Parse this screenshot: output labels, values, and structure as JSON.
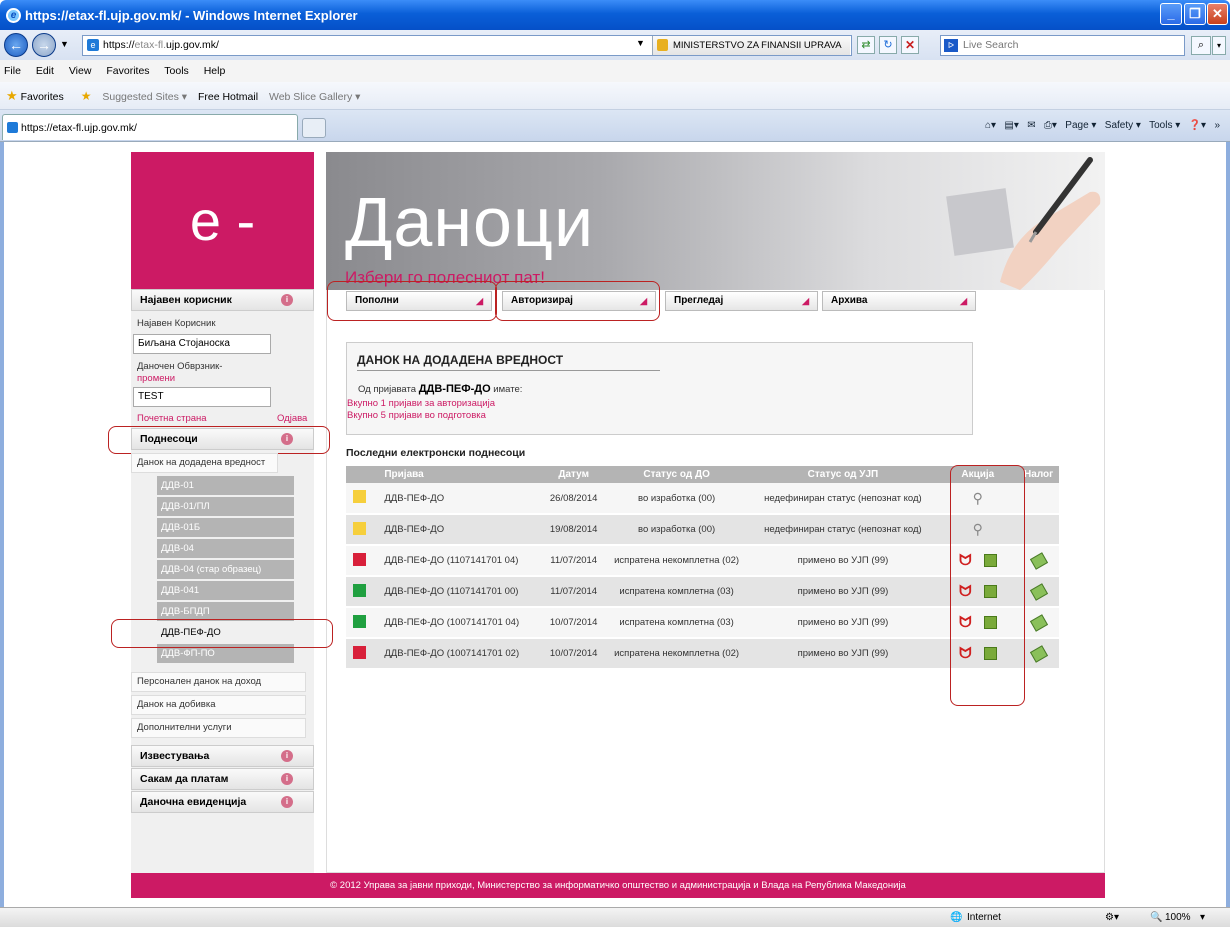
{
  "window": {
    "title": "https://etax-fl.ujp.gov.mk/ - Windows Internet Explorer"
  },
  "address": {
    "prefix": "https://",
    "host_dim": "etax-fl.",
    "host": "ujp.gov.mk/",
    "security": "MINISTERSTVO ZA FINANSII UPRAVA ...",
    "search_placeholder": "Live Search"
  },
  "menu": [
    "File",
    "Edit",
    "View",
    "Favorites",
    "Tools",
    "Help"
  ],
  "favorites": {
    "label": "Favorites",
    "items": [
      "Suggested Sites ▾",
      "Free Hotmail",
      "Web Slice Gallery ▾"
    ]
  },
  "tab": {
    "label": "https://etax-fl.ujp.gov.mk/"
  },
  "toolbar": {
    "page": "Page ▾",
    "safety": "Safety ▾",
    "tools": "Tools ▾"
  },
  "page": {
    "logo": "e -",
    "banner_title": "Даноци",
    "banner_sub": "Избери го полесниот пат!",
    "nav": [
      "Пополни",
      "Авторизирај",
      "Прегледај",
      "Архива"
    ],
    "sidebar": {
      "logged_header": "Најавен корисник",
      "user_label": "Најавен Корисник",
      "user_value": "Биљана Стојаноска",
      "taxpayer_label": "Даночен Обврзник-",
      "change_link": "промени",
      "taxpayer_value": "TEST",
      "home_link": "Почетна страна",
      "logout_link": "Одјава",
      "submissions_header": "Поднесоци",
      "vat_item": "Данок на додадена вредност",
      "ddv_items": [
        "ДДВ-01",
        "ДДВ-01/ПЛ",
        "ДДВ-01Б",
        "ДДВ-04",
        "ДДВ-04 (стар образец)",
        "ДДВ-041",
        "ДДВ-БПДП",
        "ДДВ-ПЕФ-ДО",
        "ДДВ-ФП-ПО"
      ],
      "other_items": [
        "Персонален данок на доход",
        "Данок на добивка",
        "Дополнителни услуги"
      ],
      "bottom_headers": [
        "Известувања",
        "Сакам да платам",
        "Даночна евиденција"
      ]
    },
    "vat": {
      "title": "ДАНОК НА ДОДАДЕНА ВРЕДНОСТ",
      "line1_pre": "Од пријавата",
      "line1_bold": "ДДВ-ПЕФ-ДО",
      "line1_post": "имате:",
      "line2": "Вкупно 1 пријави за авторизација",
      "line3": "Вкупно 5 пријави во подготовка"
    },
    "last_title": "Последни електронски поднесоци",
    "columns": [
      "Пријава",
      "Датум",
      "Статус од ДО",
      "Статус од УЈП",
      "Акција",
      "Налог"
    ],
    "rows": [
      {
        "color": "#f6cf3c",
        "name": "ДДВ-ПЕФ-ДО",
        "date": "26/08/2014",
        "status_do": "во изработка (00)",
        "status_ujp": "недефиниран статус (непознат код)",
        "actions": "view"
      },
      {
        "color": "#f6cf3c",
        "name": "ДДВ-ПЕФ-ДО",
        "date": "19/08/2014",
        "status_do": "во изработка (00)",
        "status_ujp": "недефиниран статус (непознат код)",
        "actions": "view"
      },
      {
        "color": "#d8203a",
        "name": "ДДВ-ПЕФ-ДО (1107141701 04)",
        "date": "11/07/2014",
        "status_do": "испратена некомплетна (02)",
        "status_ujp": "примено во УЈП (99)",
        "actions": "full"
      },
      {
        "color": "#20a040",
        "name": "ДДВ-ПЕФ-ДО (1107141701 00)",
        "date": "11/07/2014",
        "status_do": "испратена комплетна (03)",
        "status_ujp": "примено во УЈП (99)",
        "actions": "full"
      },
      {
        "color": "#20a040",
        "name": "ДДВ-ПЕФ-ДО (1007141701 04)",
        "date": "10/07/2014",
        "status_do": "испратена комплетна (03)",
        "status_ujp": "примено во УЈП (99)",
        "actions": "full"
      },
      {
        "color": "#d8203a",
        "name": "ДДВ-ПЕФ-ДО (1007141701 02)",
        "date": "10/07/2014",
        "status_do": "испратена некомплетна (02)",
        "status_ujp": "примено во УЈП (99)",
        "actions": "full"
      }
    ],
    "footer": "© 2012 Управа за јавни приходи, Министерство за информатичко општество и администрација и Влада на Република Македонија"
  },
  "status": {
    "zone": "Internet",
    "zoom": "100%"
  }
}
